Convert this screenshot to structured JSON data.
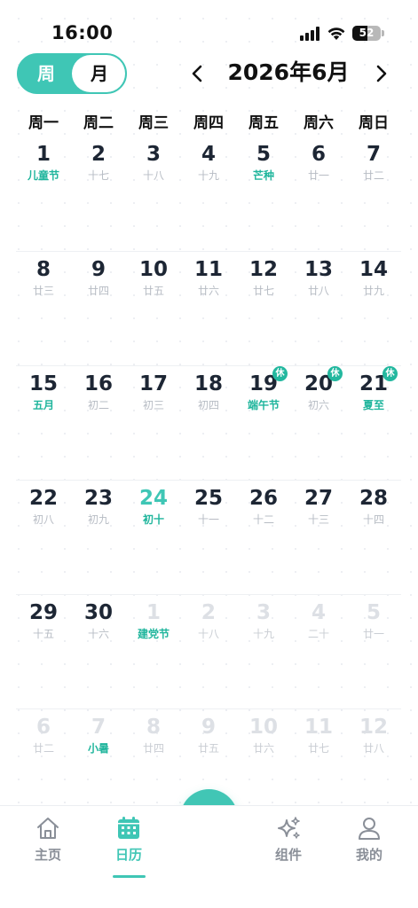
{
  "status_bar": {
    "time": "16:00",
    "battery": "52",
    "battery_level": 0.52
  },
  "header": {
    "toggle_week": "周",
    "toggle_month": "月",
    "month_title": "2026年6月"
  },
  "weekdays": [
    "周一",
    "周二",
    "周三",
    "周四",
    "周五",
    "周六",
    "周日"
  ],
  "weeks": [
    [
      {
        "num": "1",
        "sub": "儿童节",
        "type": "festival"
      },
      {
        "num": "2",
        "sub": "十七"
      },
      {
        "num": "3",
        "sub": "十八"
      },
      {
        "num": "4",
        "sub": "十九"
      },
      {
        "num": "5",
        "sub": "芒种",
        "type": "festival"
      },
      {
        "num": "6",
        "sub": "廿一"
      },
      {
        "num": "7",
        "sub": "廿二"
      }
    ],
    [
      {
        "num": "8",
        "sub": "廿三"
      },
      {
        "num": "9",
        "sub": "廿四"
      },
      {
        "num": "10",
        "sub": "廿五"
      },
      {
        "num": "11",
        "sub": "廿六"
      },
      {
        "num": "12",
        "sub": "廿七"
      },
      {
        "num": "13",
        "sub": "廿八"
      },
      {
        "num": "14",
        "sub": "廿九"
      }
    ],
    [
      {
        "num": "15",
        "sub": "五月",
        "type": "festival"
      },
      {
        "num": "16",
        "sub": "初二"
      },
      {
        "num": "17",
        "sub": "初三"
      },
      {
        "num": "18",
        "sub": "初四"
      },
      {
        "num": "19",
        "sub": "端午节",
        "type": "festival",
        "badge": "休"
      },
      {
        "num": "20",
        "sub": "初六",
        "badge": "休"
      },
      {
        "num": "21",
        "sub": "夏至",
        "type": "festival",
        "badge": "休"
      }
    ],
    [
      {
        "num": "22",
        "sub": "初八"
      },
      {
        "num": "23",
        "sub": "初九"
      },
      {
        "num": "24",
        "sub": "初十",
        "type": "today"
      },
      {
        "num": "25",
        "sub": "十一"
      },
      {
        "num": "26",
        "sub": "十二"
      },
      {
        "num": "27",
        "sub": "十三"
      },
      {
        "num": "28",
        "sub": "十四"
      }
    ],
    [
      {
        "num": "29",
        "sub": "十五"
      },
      {
        "num": "30",
        "sub": "十六"
      },
      {
        "num": "1",
        "sub": "建党节",
        "type": "other festival"
      },
      {
        "num": "2",
        "sub": "十八",
        "type": "other"
      },
      {
        "num": "3",
        "sub": "十九",
        "type": "other"
      },
      {
        "num": "4",
        "sub": "二十",
        "type": "other"
      },
      {
        "num": "5",
        "sub": "廿一",
        "type": "other"
      }
    ],
    [
      {
        "num": "6",
        "sub": "廿二",
        "type": "other"
      },
      {
        "num": "7",
        "sub": "小暑",
        "type": "other festival"
      },
      {
        "num": "8",
        "sub": "廿四",
        "type": "other"
      },
      {
        "num": "9",
        "sub": "廿五",
        "type": "other"
      },
      {
        "num": "10",
        "sub": "廿六",
        "type": "other"
      },
      {
        "num": "11",
        "sub": "廿七",
        "type": "other"
      },
      {
        "num": "12",
        "sub": "廿八",
        "type": "other"
      }
    ]
  ],
  "nav": {
    "home": "主页",
    "calendar": "日历",
    "widgets": "组件",
    "profile": "我的",
    "active": "calendar"
  },
  "icons": {
    "prev": "chevron-left-icon",
    "next": "chevron-right-icon",
    "fab": "plus-icon",
    "home": "home-icon",
    "calendar": "calendar-icon",
    "widgets": "sparkles-icon",
    "profile": "person-icon"
  },
  "colors": {
    "accent": "#3fc6b5",
    "festival": "#1fb59c",
    "badge": "#23b89f"
  }
}
